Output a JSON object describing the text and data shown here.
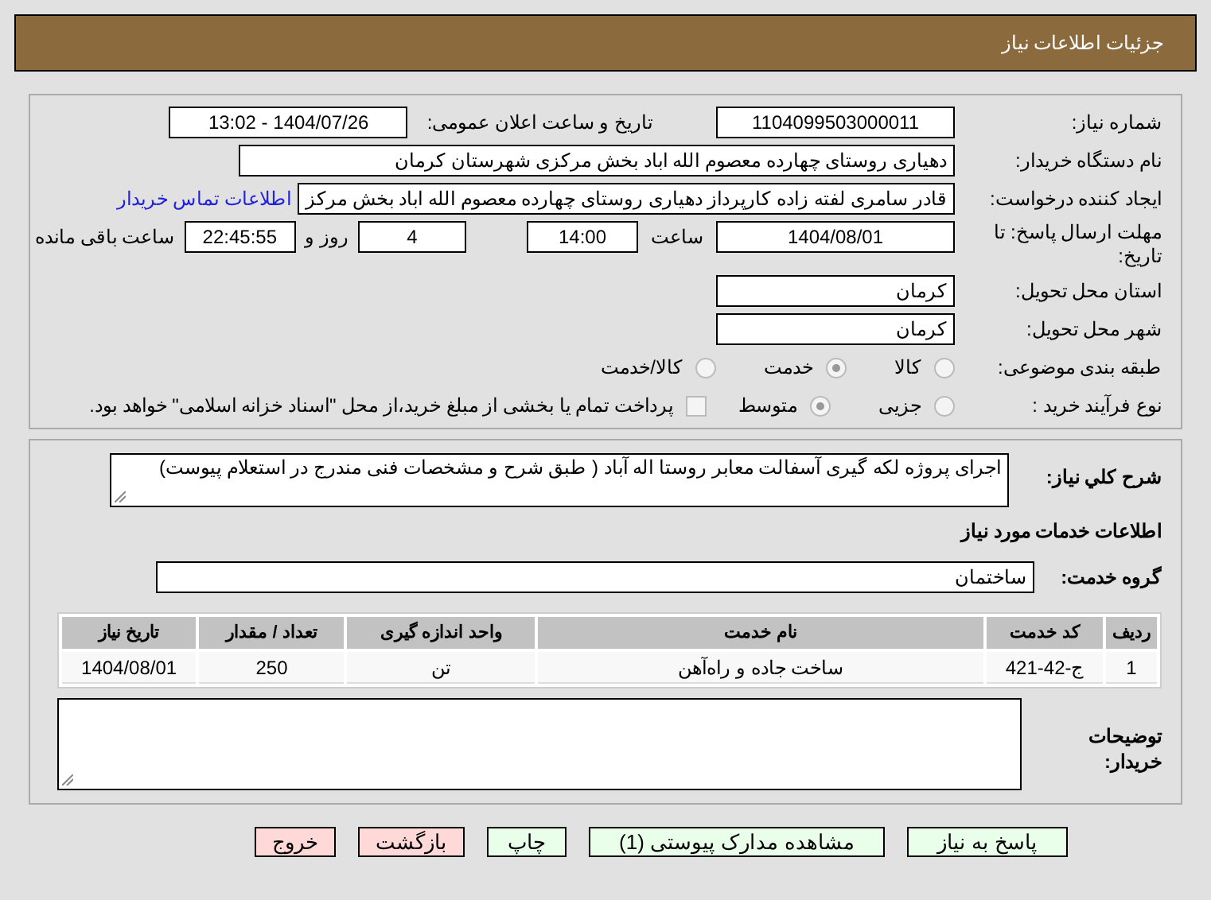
{
  "header": {
    "title": "جزئیات اطلاعات نیاز"
  },
  "need_number": {
    "label": "شماره نیاز:",
    "value": "1104099503000011"
  },
  "announce": {
    "label": "تاریخ و ساعت اعلان عمومی:",
    "value": "1404/07/26 - 13:02"
  },
  "buyer": {
    "label": "نام دستگاه خریدار:",
    "value": "دهیاری روستای چهارده معصوم الله اباد بخش مرکزی شهرستان کرمان"
  },
  "creator": {
    "label": "ایجاد کننده درخواست:",
    "value": "قادر سامری لفته زاده کارپرداز دهیاری روستای چهارده معصوم الله اباد بخش مرکز",
    "link": "اطلاعات تماس خریدار"
  },
  "deadline": {
    "label": "مهلت ارسال پاسخ: تا تاریخ:",
    "date": "1404/08/01",
    "time_label": "ساعت",
    "time": "14:00",
    "days": "4",
    "days_label": "روز و",
    "remaining": "22:45:55",
    "remaining_label": "ساعت باقی مانده"
  },
  "province": {
    "label": "استان محل تحویل:",
    "value": "کرمان"
  },
  "city": {
    "label": "شهر محل تحویل:",
    "value": "کرمان"
  },
  "category": {
    "label": "طبقه بندی موضوعی:",
    "options": [
      {
        "label": "کالا",
        "selected": false
      },
      {
        "label": "خدمت",
        "selected": true
      },
      {
        "label": "کالا/خدمت",
        "selected": false
      }
    ]
  },
  "process": {
    "label": "نوع فرآیند خرید :",
    "options": [
      {
        "label": "جزیی",
        "selected": false
      },
      {
        "label": "متوسط",
        "selected": true
      }
    ],
    "payment": {
      "checked": false,
      "text": "پرداخت تمام یا بخشی از مبلغ خرید،از محل \"اسناد خزانه اسلامی\" خواهد بود."
    }
  },
  "description": {
    "label": "شرح کلي نياز:",
    "value": "اجرای پروژه لکه گیری آسفالت معابر روستا اله آباد ( طبق شرح و مشخصات فنی مندرج در استعلام پیوست)"
  },
  "services_heading": "اطلاعات خدمات مورد نیاز",
  "service_group": {
    "label": "گروه خدمت:",
    "value": "ساختمان"
  },
  "table": {
    "columns": [
      "ردیف",
      "کد خدمت",
      "نام خدمت",
      "واحد اندازه گیری",
      "تعداد / مقدار",
      "تاریخ نیاز"
    ],
    "rows": [
      [
        "1",
        "ج-42-421",
        "ساخت جاده و راه‌آهن",
        "تن",
        "250",
        "1404/08/01"
      ]
    ]
  },
  "buyer_notes": {
    "label": "توضیحات خریدار:"
  },
  "buttons": [
    {
      "label": "پاسخ به نیاز",
      "kind": "action"
    },
    {
      "label": "مشاهده مدارک پیوستی (1)",
      "kind": "action"
    },
    {
      "label": "چاپ",
      "kind": "action"
    },
    {
      "label": "بازگشت",
      "kind": "exit"
    },
    {
      "label": "خروج",
      "kind": "exit"
    }
  ]
}
